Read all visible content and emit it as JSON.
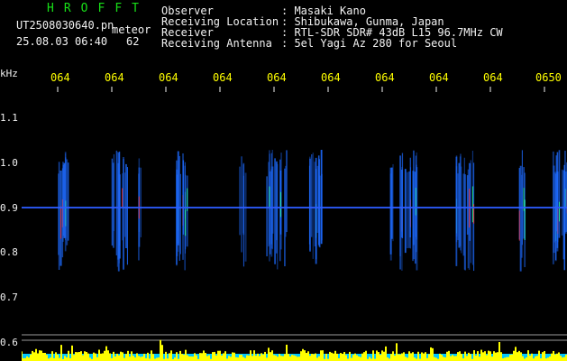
{
  "header": {
    "title_letters": [
      "H",
      "R",
      "O",
      "F",
      "F",
      "T"
    ],
    "filename": "UT2508030640.pn",
    "meteor_label": "meteor",
    "datetime": "25.08.03 06:40",
    "count": "62",
    "fields": [
      {
        "label": "Observer",
        "value": ": Masaki Kano"
      },
      {
        "label": "Receiving Location",
        "value": ": Shibukawa, Gunma, Japan"
      },
      {
        "label": "Receiver",
        "value": ": RTL-SDR SDR# 43dB L15 96.7MHz CW"
      },
      {
        "label": "Receiving Antenna",
        "value": ": 5el Yagi Az 280 for Seoul"
      }
    ]
  },
  "axes": {
    "y_unit": "kHz",
    "y_ticks": [
      "1.1",
      "1.0",
      "0.9",
      "0.8",
      "0.7",
      "0.6"
    ],
    "x_ticks": [
      "064",
      "064",
      "064",
      "064",
      "064",
      "064",
      "064",
      "064",
      "064",
      "0650"
    ]
  },
  "colors": {
    "background": "#000000",
    "title": "#18e018",
    "text": "#f2f2f2",
    "tick_label": "#ffff00",
    "carrier": "#2d5cff",
    "meteor_echo": "#1e6bff",
    "meteor_core": "#2aff9a",
    "echo_hot": "#ff3030",
    "level_trace": "#ffff00",
    "level_base": "#00c8ff"
  }
}
